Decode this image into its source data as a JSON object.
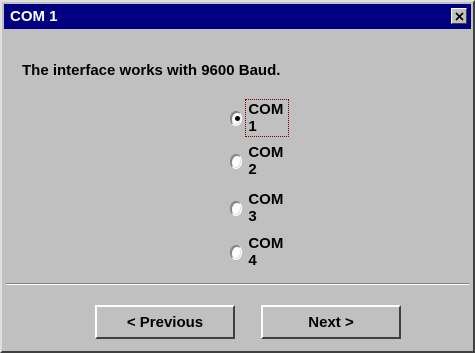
{
  "window": {
    "title": "COM 1"
  },
  "message": "The interface works with 9600 Baud.",
  "ports": [
    {
      "label": "COM 1",
      "selected": true
    },
    {
      "label": "COM 2",
      "selected": false
    },
    {
      "label": "COM 3",
      "selected": false
    },
    {
      "label": "COM 4",
      "selected": false
    }
  ],
  "buttons": {
    "previous": "< Previous",
    "next": "Next >"
  },
  "colors": {
    "titlebar": "#000080",
    "face": "#c0c0c0"
  },
  "icons": {
    "close": "close-icon",
    "radio": "radio-button"
  }
}
